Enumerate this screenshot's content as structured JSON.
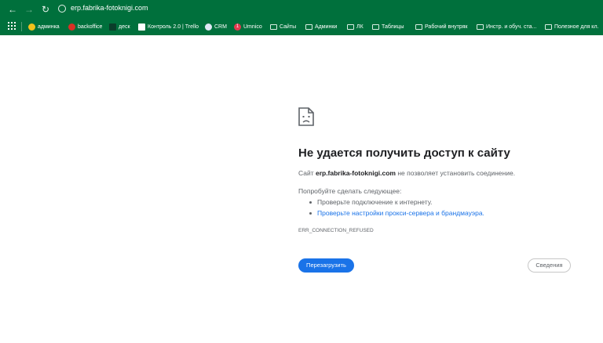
{
  "browser": {
    "url": "erp.fabrika-fotoknigi.com",
    "accent_color": "#00703c",
    "bookmarks": [
      {
        "label": "админка",
        "icon": "yellow-circle-icon",
        "color": "#f2c21b"
      },
      {
        "label": "backoffice",
        "icon": "red-circle-icon",
        "color": "#d93025"
      },
      {
        "label": "деск",
        "icon": "desk-icon",
        "color": "#0b3d2a"
      },
      {
        "label": "Контроль 2.0 | Trello",
        "icon": "trello-icon",
        "color": "#ffffff"
      },
      {
        "label": "CRM",
        "icon": "crm-icon",
        "color": "#dfe7f4"
      },
      {
        "label": "Umnico",
        "icon": "umnico-icon",
        "color": "#e53950"
      },
      {
        "label": "Сайты",
        "icon": "folder-icon"
      },
      {
        "label": "Админки",
        "icon": "folder-icon"
      },
      {
        "label": "ЛК",
        "icon": "folder-icon"
      },
      {
        "label": "Таблицы",
        "icon": "folder-icon"
      },
      {
        "label": "Рабочий внутряк",
        "icon": "folder-icon"
      },
      {
        "label": "Инстр. и обуч. ста...",
        "icon": "folder-icon"
      },
      {
        "label": "Полезное для кл.",
        "icon": "folder-icon"
      }
    ],
    "umnico_badge": "1"
  },
  "error": {
    "heading": "Не удается получить доступ к сайту",
    "line_prefix": "Сайт ",
    "host": "erp.fabrika-fotoknigi.com",
    "line_suffix": " не позволяет установить соединение.",
    "try_label": "Попробуйте сделать следующее:",
    "suggestions": [
      "Проверьте подключение к интернету.",
      "Проверьте настройки прокси-сервера и брандмауэра."
    ],
    "code": "ERR_CONNECTION_REFUSED",
    "reload_label": "Перезагрузить",
    "details_label": "Сведения",
    "link_color": "#1a73e8"
  }
}
